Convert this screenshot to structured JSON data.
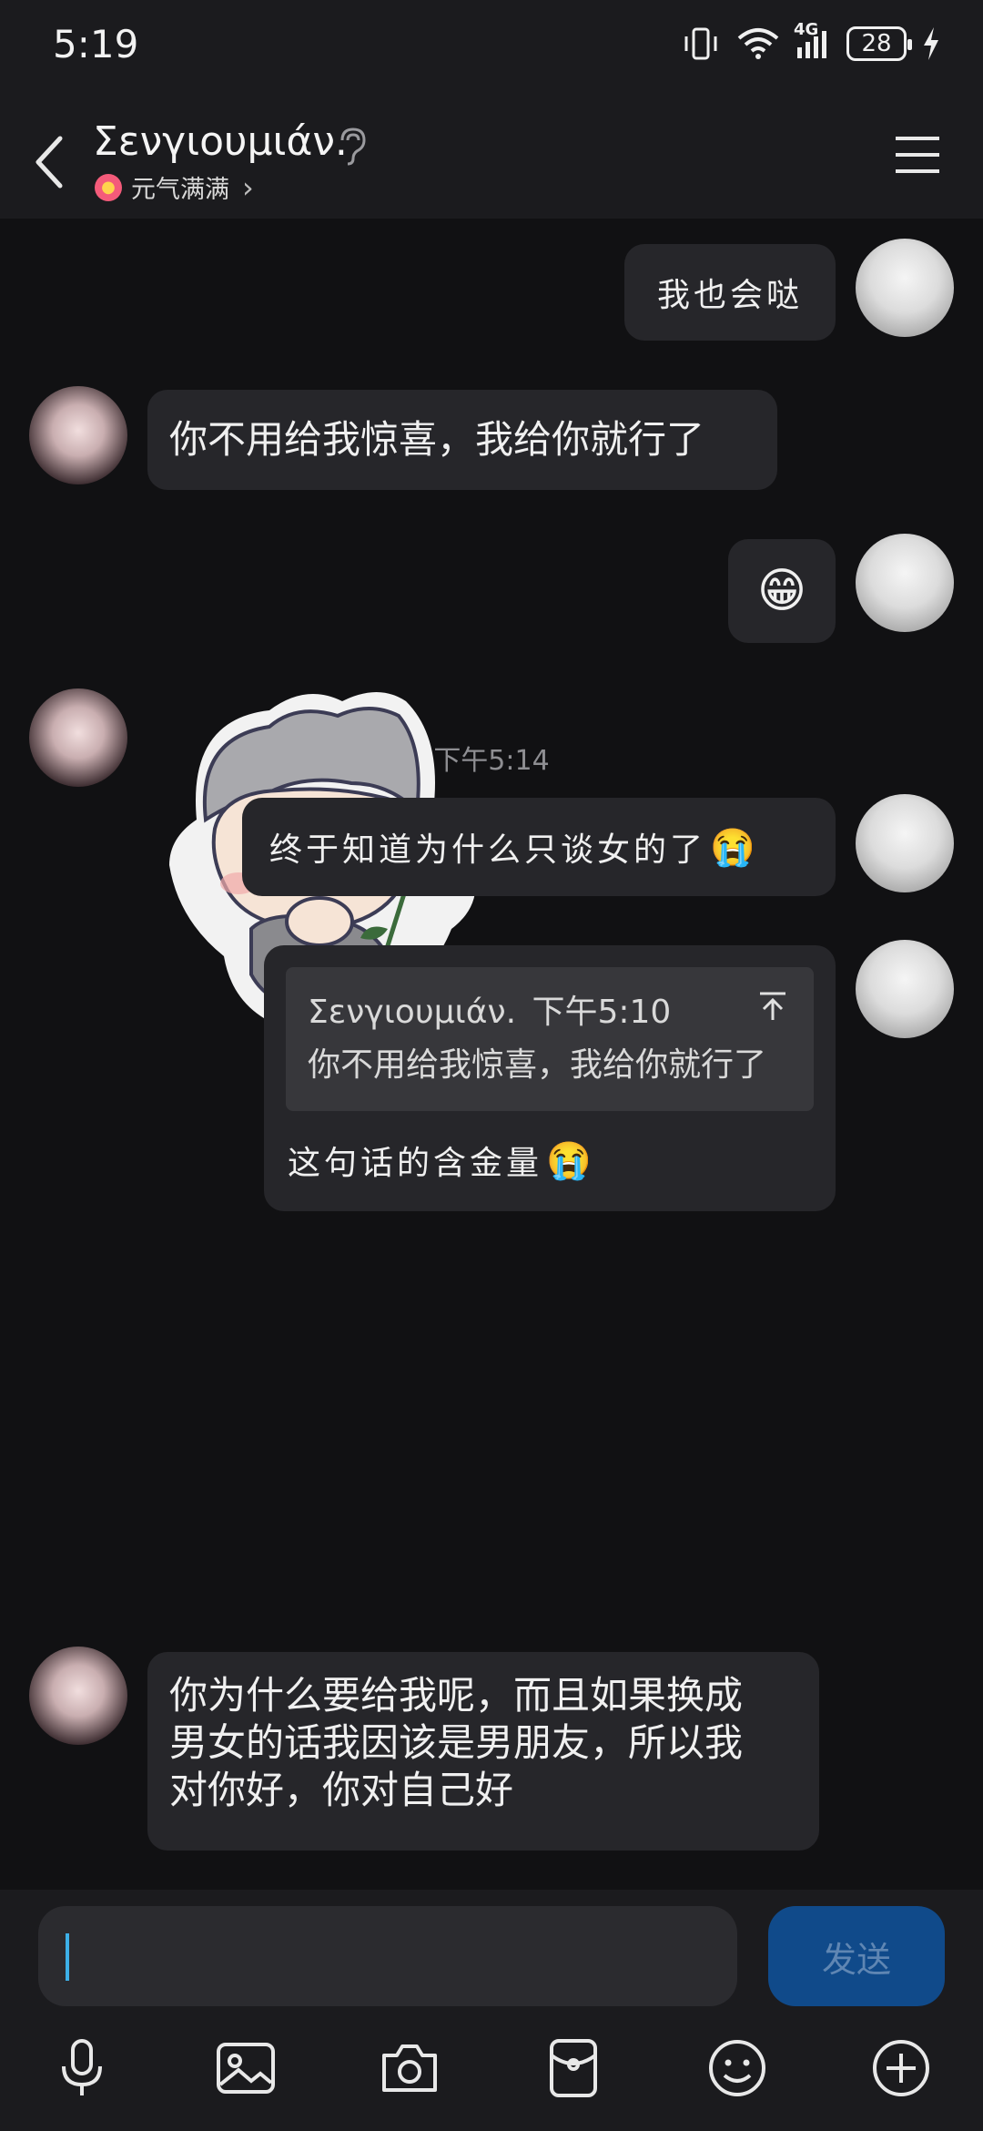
{
  "status_bar": {
    "time": "5:19",
    "network": "4G",
    "battery": "28"
  },
  "header": {
    "contact_name": "Σενγιουμιάν.",
    "status_text": "元气满满",
    "status_chevron": "›"
  },
  "messages": {
    "m1": {
      "text": "我也会哒"
    },
    "m2": {
      "text": "你不用给我惊喜，我给你就行了"
    },
    "m3": {
      "emoji": "😁"
    },
    "separator": "下午5:14",
    "m5": {
      "text": "终于知道为什么只谈女的了",
      "emoji": "😭"
    },
    "m6": {
      "quote_author": "Σενγιουμιάν.",
      "quote_time": "下午5:10",
      "quote_text": "你不用给我惊喜，我给你就行了",
      "text": "这句话的含金量",
      "emoji": "😭"
    },
    "m7": {
      "lines": [
        "你为什么要给我呢，而且如果换成",
        "男女的话我因该是男朋友，所以我",
        "对你好，你对自己好"
      ]
    }
  },
  "input": {
    "placeholder": "",
    "send_label": "发送"
  },
  "toolbar": {
    "icons": [
      "microphone-icon",
      "image-icon",
      "camera-icon",
      "red-packet-icon",
      "emoji-icon",
      "plus-icon"
    ]
  },
  "colors": {
    "background": "#111113",
    "bubble": "#26262a",
    "send_button": "#104a8a",
    "caret": "#3db0e8"
  }
}
